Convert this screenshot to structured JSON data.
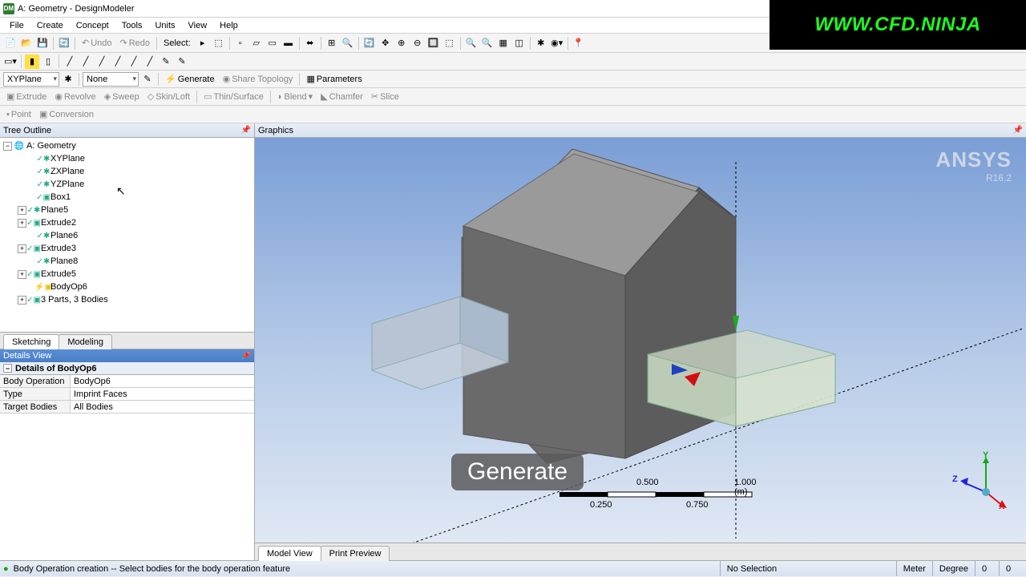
{
  "window": {
    "title": "A: Geometry - DesignModeler"
  },
  "menu": [
    "File",
    "Create",
    "Concept",
    "Tools",
    "Units",
    "View",
    "Help"
  ],
  "toolbar1": {
    "undo": "Undo",
    "redo": "Redo",
    "select": "Select:"
  },
  "toolbar3": {
    "plane": "XYPlane",
    "sketch": "None",
    "generate": "Generate",
    "share": "Share Topology",
    "params": "Parameters"
  },
  "toolbar4": {
    "extrude": "Extrude",
    "revolve": "Revolve",
    "sweep": "Sweep",
    "skin": "Skin/Loft",
    "thin": "Thin/Surface",
    "blend": "Blend",
    "chamfer": "Chamfer",
    "slice": "Slice"
  },
  "toolbar5": {
    "point": "Point",
    "conversion": "Conversion"
  },
  "panels": {
    "tree": "Tree Outline",
    "graphics": "Graphics",
    "details": "Details View"
  },
  "tree": {
    "root": "A: Geometry",
    "items": [
      {
        "label": "XYPlane"
      },
      {
        "label": "ZXPlane"
      },
      {
        "label": "YZPlane"
      },
      {
        "label": "Box1"
      },
      {
        "label": "Plane5",
        "exp": "+"
      },
      {
        "label": "Extrude2",
        "exp": "+"
      },
      {
        "label": "Plane6"
      },
      {
        "label": "Extrude3",
        "exp": "+"
      },
      {
        "label": "Plane8"
      },
      {
        "label": "Extrude5",
        "exp": "+"
      },
      {
        "label": "BodyOp6"
      },
      {
        "label": "3 Parts, 3 Bodies",
        "exp": "+"
      }
    ]
  },
  "tabs": {
    "sketching": "Sketching",
    "modeling": "Modeling"
  },
  "details": {
    "title": "Details of BodyOp6",
    "rows": [
      {
        "k": "Body Operation",
        "v": "BodyOp6"
      },
      {
        "k": "Type",
        "v": "Imprint Faces"
      },
      {
        "k": "Target Bodies",
        "v": "All Bodies"
      }
    ]
  },
  "viewtabs": {
    "model": "Model View",
    "print": "Print Preview"
  },
  "status": {
    "msg": "Body Operation creation -- Select bodies for the body operation feature",
    "sel": "No Selection",
    "unit1": "Meter",
    "unit2": "Degree",
    "c1": "0",
    "c2": "0"
  },
  "logo": {
    "name": "ANSYS",
    "ver": "R16.2"
  },
  "triad": {
    "x": "X",
    "y": "Y",
    "z": "Z"
  },
  "scale": {
    "s0": "0.250",
    "s1": "0.500",
    "s2": "0.750",
    "s3": "1.000 (m)"
  },
  "overlay": "Generate",
  "watermark": "WWW.CFD.NINJA"
}
